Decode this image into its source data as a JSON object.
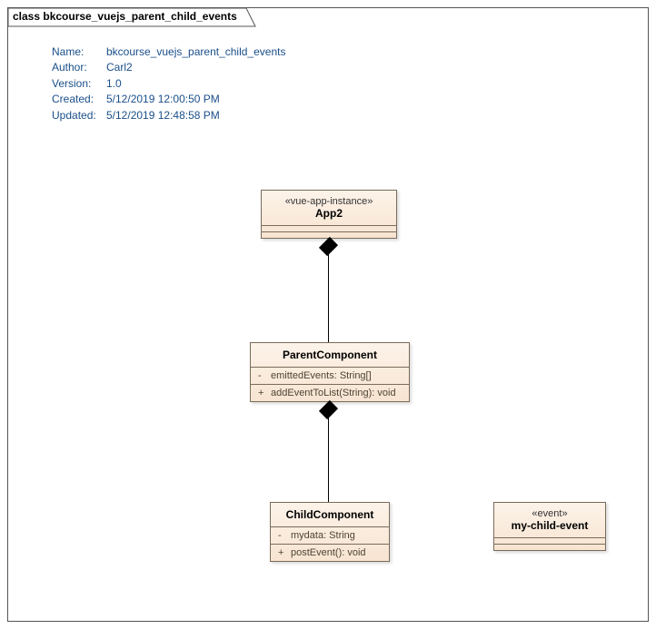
{
  "diagram": {
    "title": "class bkcourse_vuejs_parent_child_events"
  },
  "meta": {
    "name_label": "Name:",
    "name_value": "bkcourse_vuejs_parent_child_events",
    "author_label": "Author:",
    "author_value": "Carl2",
    "version_label": "Version:",
    "version_value": "1.0",
    "created_label": "Created:",
    "created_value": "5/12/2019 12:00:50 PM",
    "updated_label": "Updated:",
    "updated_value": "5/12/2019 12:48:58 PM"
  },
  "classes": {
    "app2": {
      "stereotype": "«vue-app-instance»",
      "name": "App2"
    },
    "parent": {
      "name": "ParentComponent",
      "attr_vis": "-",
      "attr": "emittedEvents: String[]",
      "op_vis": "+",
      "op": "addEventToList(String): void"
    },
    "child": {
      "name": "ChildComponent",
      "attr_vis": "-",
      "attr": "mydata: String",
      "op_vis": "+",
      "op": "postEvent(): void"
    },
    "event": {
      "stereotype": "«event»",
      "name": "my-child-event"
    }
  }
}
